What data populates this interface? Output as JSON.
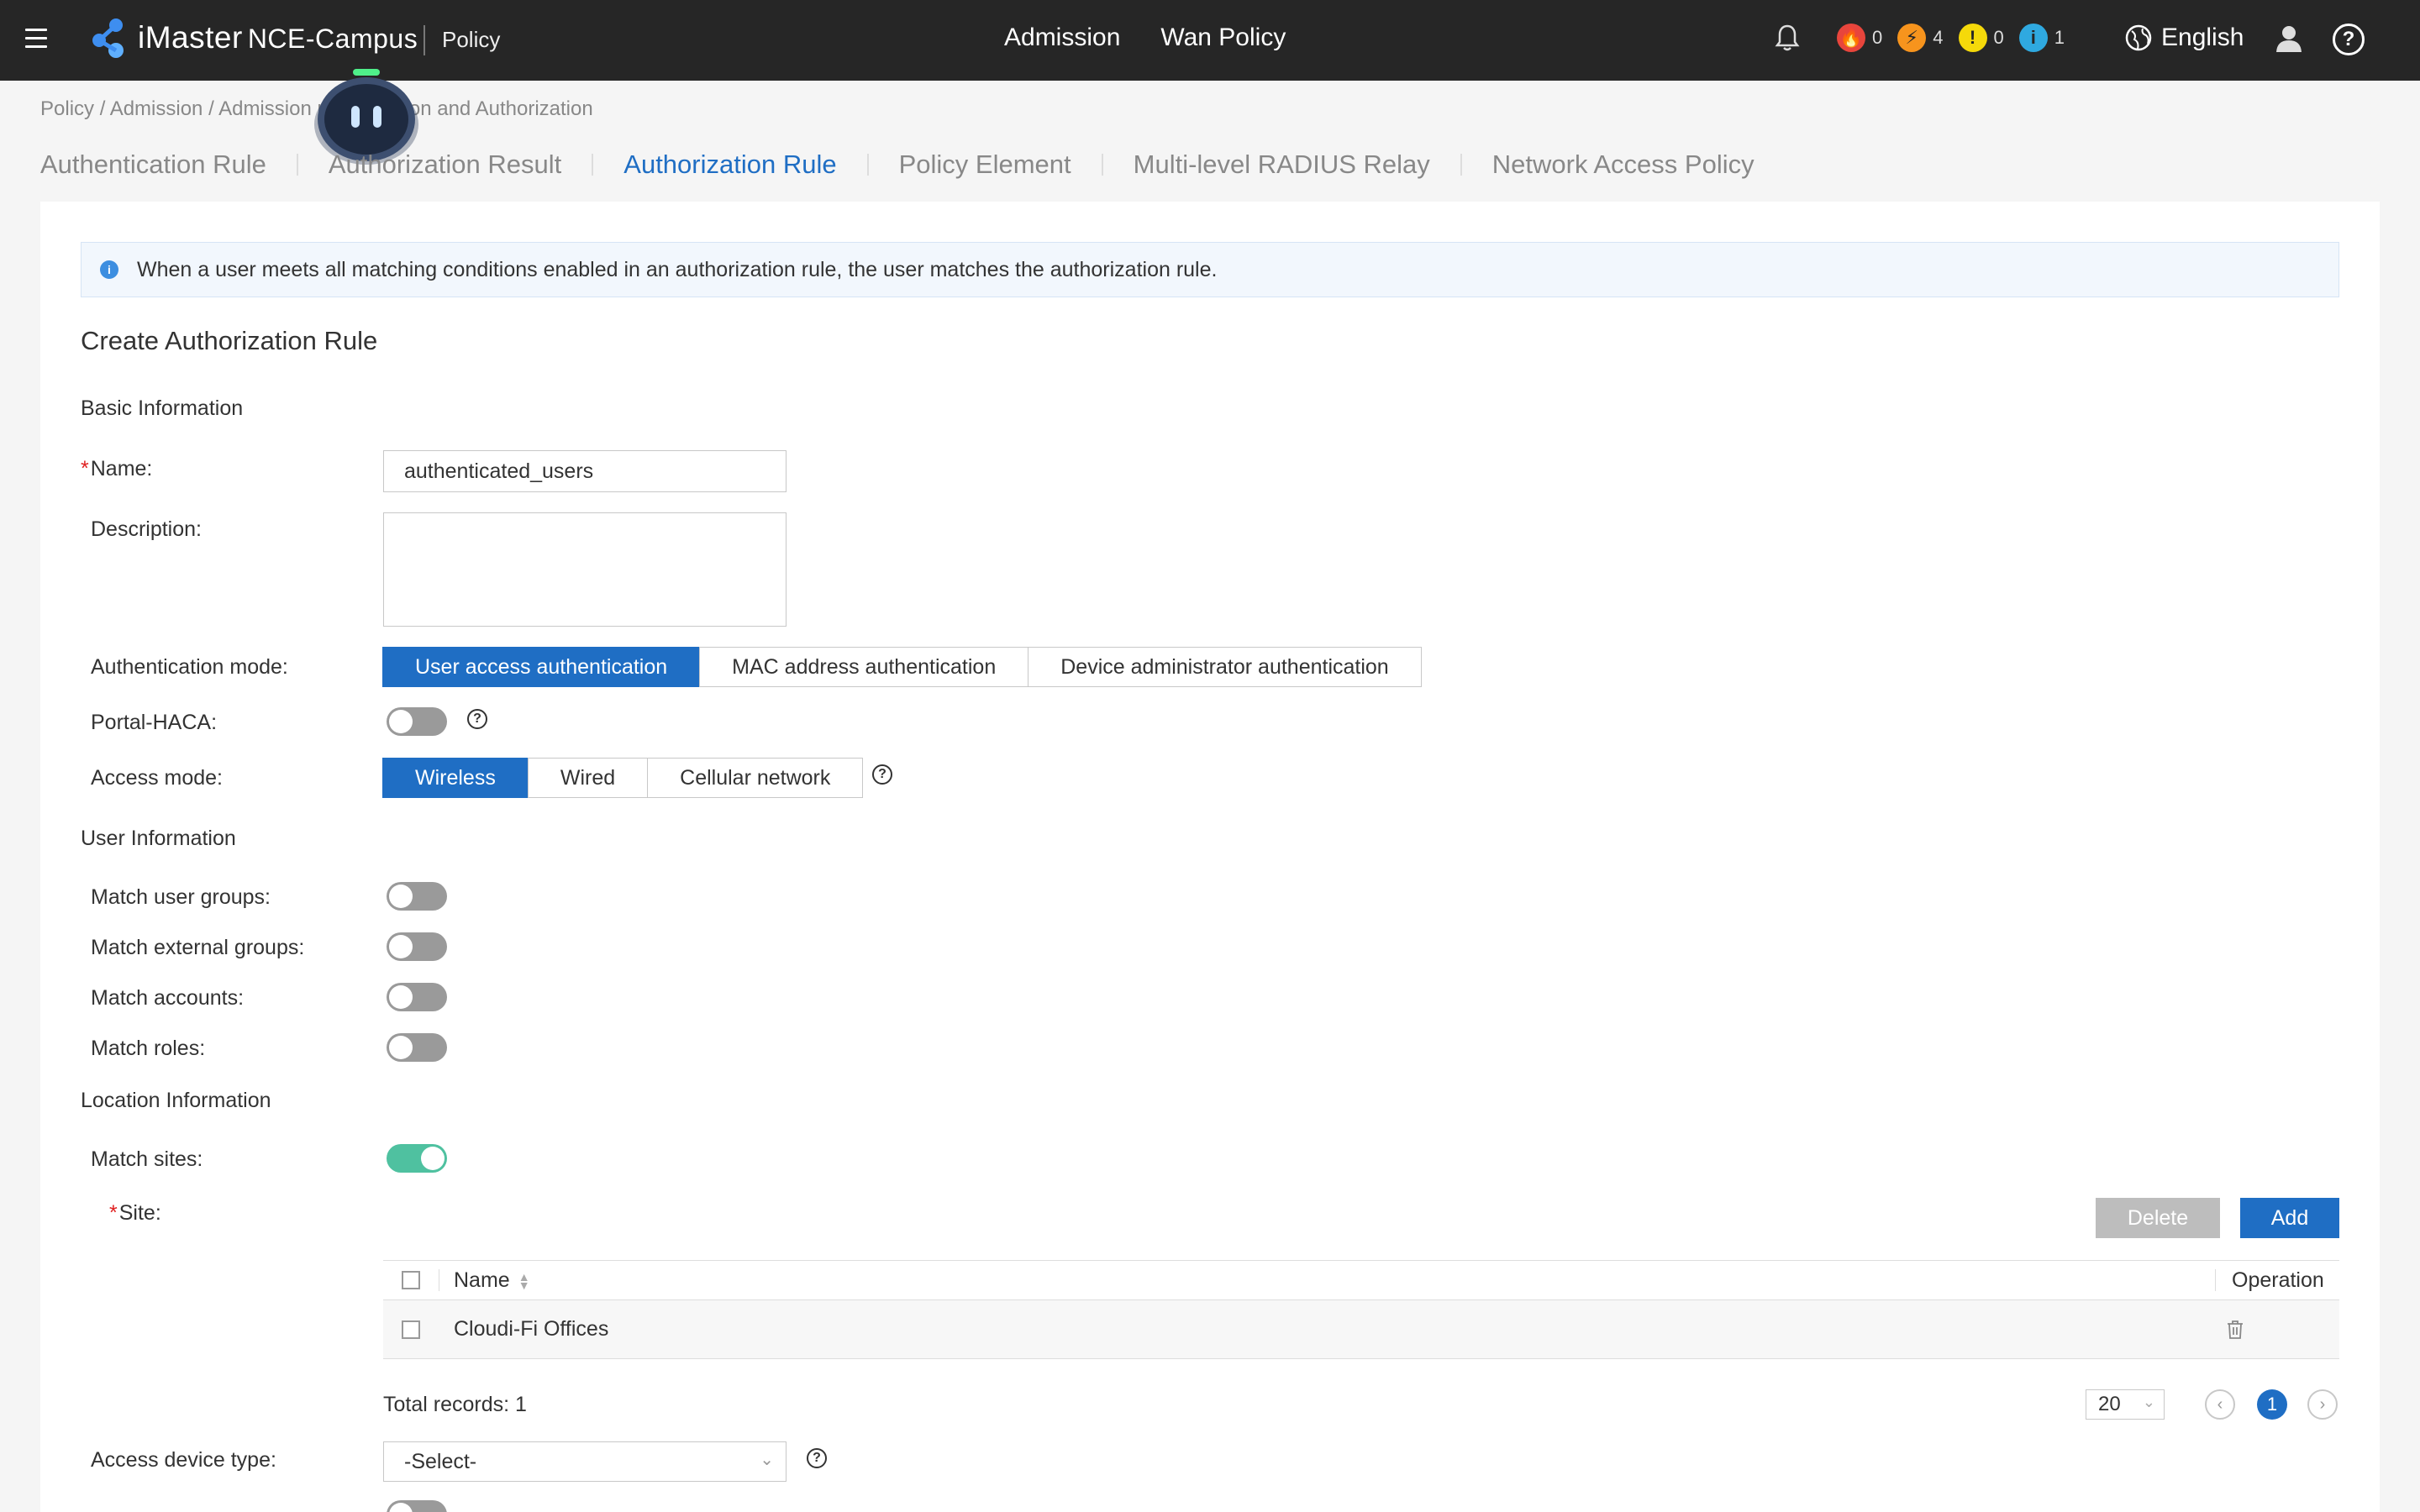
{
  "app": {
    "brand": "iMaster",
    "product": "NCE-Campus",
    "module": "Policy"
  },
  "topnav": [
    "Admission",
    "Wan Policy"
  ],
  "alarms": [
    {
      "icon": "critical-alarm-icon",
      "count": "0",
      "color": "#e8453c"
    },
    {
      "icon": "major-alarm-icon",
      "count": "4",
      "color": "#f7941d"
    },
    {
      "icon": "minor-alarm-icon",
      "count": "0",
      "color": "#f5d90a"
    },
    {
      "icon": "warning-alarm-icon",
      "count": "1",
      "color": "#2fa9e0"
    }
  ],
  "language": "English",
  "breadcrumb": "Policy / Admission / Admission                  uthentication and Authorization",
  "tabs": [
    "Authentication Rule",
    "Authorization Result",
    "Authorization Rule",
    "Policy Element",
    "Multi-level RADIUS Relay",
    "Network Access Policy"
  ],
  "active_tab": "Authorization Rule",
  "info": "When a user meets all matching conditions enabled in an authorization rule, the user matches the authorization rule.",
  "form": {
    "title": "Create Authorization Rule",
    "basic_info": "Basic Information",
    "name_label": "Name:",
    "name_value": "authenticated_users",
    "description_label": "Description:",
    "auth_mode_label": "Authentication mode:",
    "auth_modes": [
      "User access authentication",
      "MAC address authentication",
      "Device administrator authentication"
    ],
    "portal_haca_label": "Portal-HACA:",
    "access_mode_label": "Access mode:",
    "access_modes": [
      "Wireless",
      "Wired",
      "Cellular network"
    ],
    "user_info": "User Information",
    "match_user_groups": "Match user groups:",
    "match_external_groups": "Match external groups:",
    "match_accounts": "Match accounts:",
    "match_roles": "Match roles:",
    "location_info": "Location Information",
    "match_sites": "Match sites:",
    "site_label": "Site:",
    "delete_label": "Delete",
    "add_label": "Add",
    "table": {
      "col_name": "Name",
      "col_operation": "Operation",
      "rows": [
        "Cloudi-Fi Offices"
      ]
    },
    "total_records": "Total records: 1",
    "page_size": "20",
    "current_page": "1",
    "access_device_type_label": "Access device type:",
    "access_device_type_value": "-Select-"
  }
}
